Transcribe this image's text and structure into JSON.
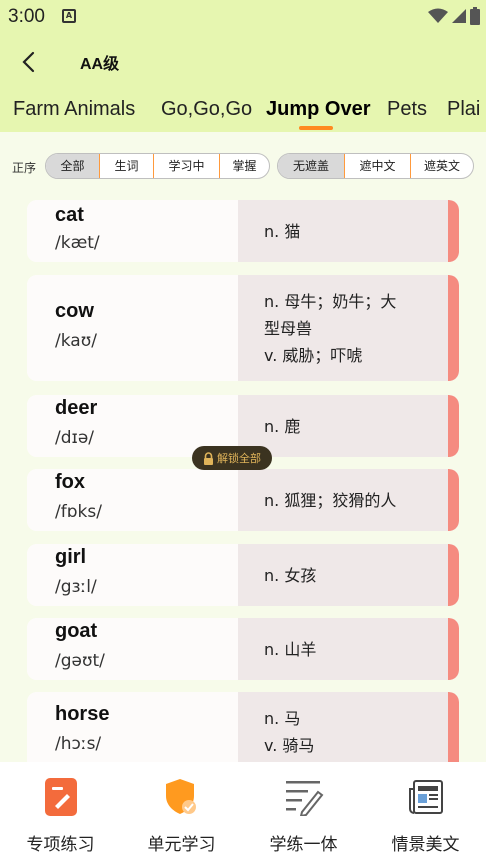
{
  "status_bar": {
    "time": "3:00",
    "notification_letter": "A"
  },
  "header": {
    "title": "AA级"
  },
  "tabs": [
    {
      "label": "Farm Animals",
      "active": false
    },
    {
      "label": "Go,Go,Go",
      "active": false
    },
    {
      "label": "Jump Over",
      "active": true
    },
    {
      "label": "Pets",
      "active": false
    },
    {
      "label": "Plai",
      "active": false
    }
  ],
  "filters": {
    "sort_label": "正序",
    "status_options": [
      "全部",
      "生词",
      "学习中",
      "掌握"
    ],
    "status_selected": "全部",
    "cover_options": [
      "无遮盖",
      "遮中文",
      "遮英文"
    ],
    "cover_selected": "无遮盖"
  },
  "words": [
    {
      "word": "cat",
      "phonetic": "/kæt/",
      "meanings": [
        "n. 猫"
      ]
    },
    {
      "word": "cow",
      "phonetic": "/kaʊ/",
      "meanings": [
        "n. 母牛；奶牛；大",
        "型母兽",
        "v. 威胁；吓唬"
      ]
    },
    {
      "word": "deer",
      "phonetic": "/dɪə/",
      "meanings": [
        "n. 鹿"
      ]
    },
    {
      "word": "fox",
      "phonetic": "/fɒks/",
      "meanings": [
        "n. 狐狸；狡猾的人"
      ]
    },
    {
      "word": "girl",
      "phonetic": "/gɜːl/",
      "meanings": [
        "n. 女孩"
      ]
    },
    {
      "word": "goat",
      "phonetic": "/gəʊt/",
      "meanings": [
        "n. 山羊"
      ]
    },
    {
      "word": "horse",
      "phonetic": "/hɔːs/",
      "meanings": [
        "n. 马",
        "v. 骑马"
      ]
    }
  ],
  "unlock_label": "解锁全部",
  "bottom_nav": [
    {
      "label": "专项练习",
      "icon": "practice-icon"
    },
    {
      "label": "单元学习",
      "icon": "shield-check-icon"
    },
    {
      "label": "学练一体",
      "icon": "pen-lines-icon"
    },
    {
      "label": "情景美文",
      "icon": "newspaper-icon"
    }
  ],
  "colors": {
    "header_bg": "#e6f6b0",
    "accent_orange": "#ff8a1f",
    "card_edge": "#f58b80",
    "unlock_text": "#e0b45a"
  }
}
